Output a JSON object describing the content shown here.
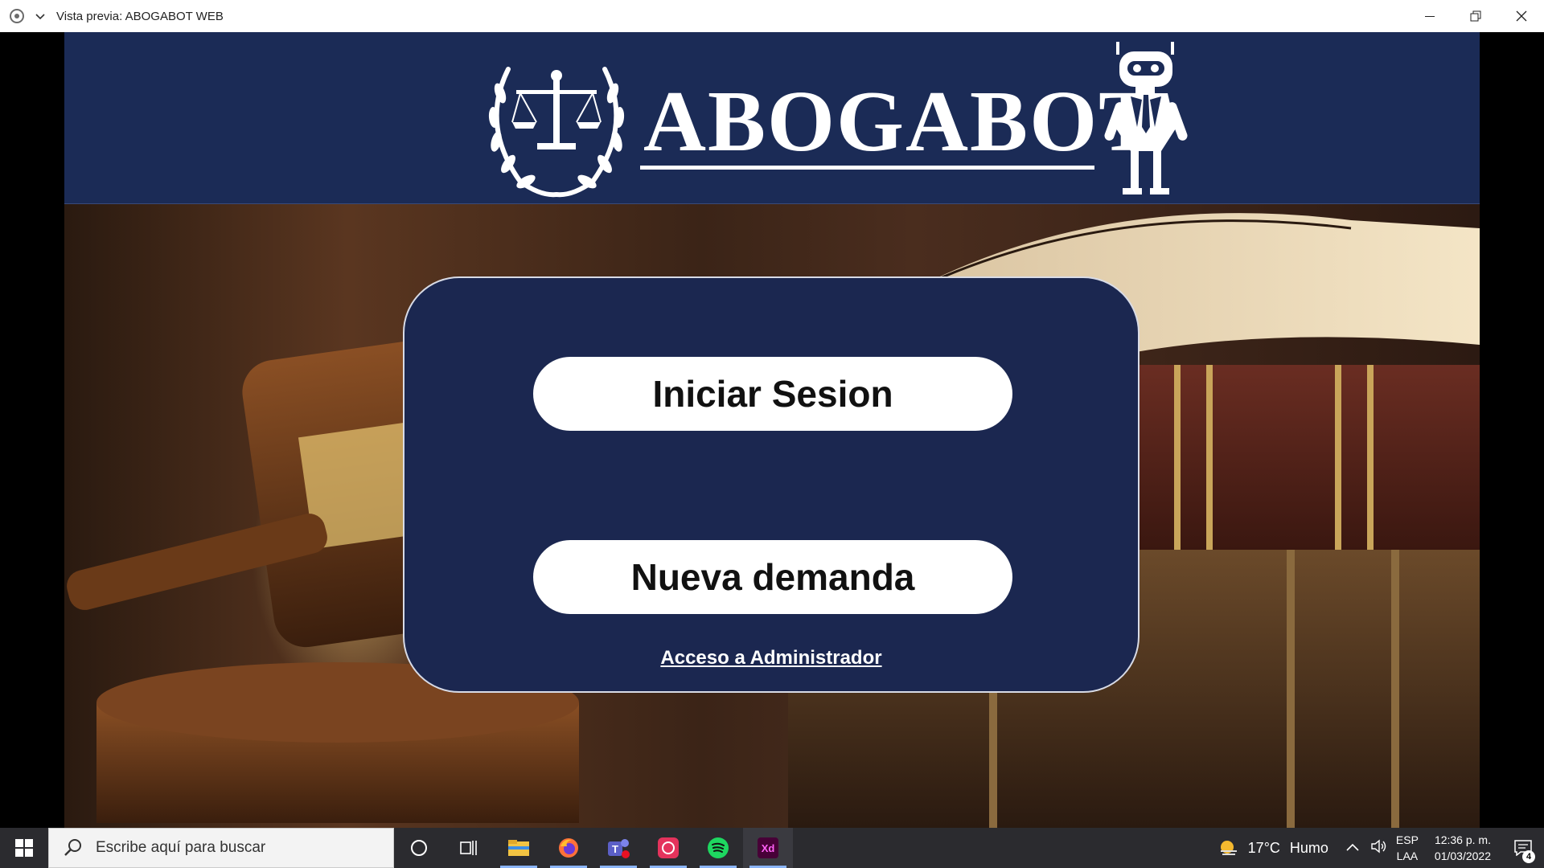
{
  "window": {
    "title": "Vista previa: ABOGABOT WEB",
    "menu_icon": "chevron-down-icon",
    "controls": [
      "minimize-icon",
      "restore-icon",
      "close-icon"
    ]
  },
  "header": {
    "brand": "ABOGABOT",
    "background_color": "#1b2b56",
    "left_emblem": "scales-of-justice-laurel-icon",
    "right_mascot": "robot-mascot-icon"
  },
  "card": {
    "background_color": "#1b2750",
    "login_label": "Iniciar Sesion",
    "new_claim_label": "Nueva demanda",
    "admin_link": "Acceso a Administrador"
  },
  "taskbar": {
    "search_placeholder": "Escribe aquí para buscar",
    "pinned": [
      "cortana-icon",
      "task-view-icon",
      "file-explorer-icon",
      "firefox-icon",
      "teams-icon",
      "creative-cloud-icon",
      "spotify-icon",
      "adobe-xd-icon"
    ],
    "weather": {
      "temperature": "17°C",
      "condition": "Humo"
    },
    "lang_primary": "ESP",
    "lang_secondary": "LAA",
    "time": "12:36 p. m.",
    "date": "01/03/2022",
    "notification_count": "4"
  }
}
